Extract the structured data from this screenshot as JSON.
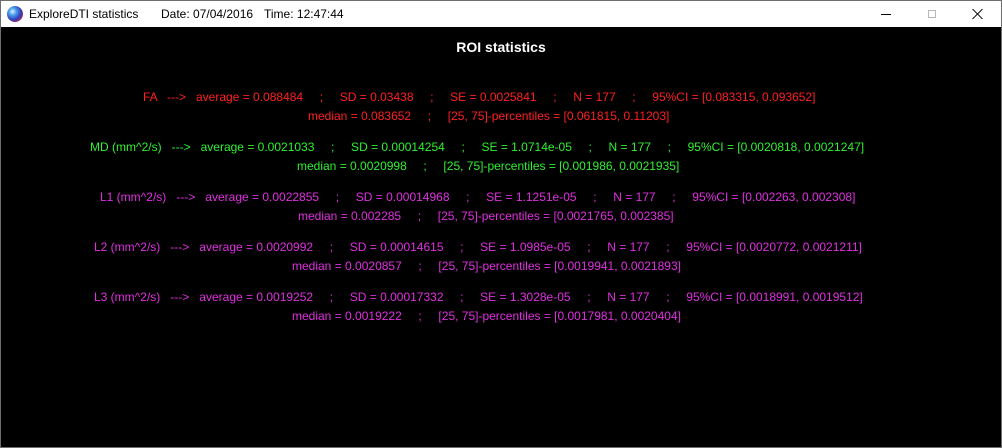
{
  "window": {
    "title": "ExploreDTI statistics",
    "date": "Date: 07/04/2016",
    "time": "Time: 12:47:44"
  },
  "content": {
    "heading": "ROI statistics",
    "rows": [
      {
        "color": "#ff2020",
        "line1": "FA   --->   average = 0.088484     ;     SD = 0.03438     ;     SE = 0.0025841     ;     N = 177     ;     95%CI = [0.083315, 0.093652]",
        "line2": "median = 0.083652     ;     [25, 75]-percentiles = [0.061815, 0.11203]"
      },
      {
        "color": "#30f030",
        "line1": "MD (mm^2/s)   --->   average = 0.0021033     ;     SD = 0.00014254     ;     SE = 1.0714e-05     ;     N = 177     ;     95%CI = [0.0020818, 0.0021247]",
        "line2": "median = 0.0020998     ;     [25, 75]-percentiles = [0.001986, 0.0021935]"
      },
      {
        "color": "#e030e0",
        "line1": "L1 (mm^2/s)   --->   average = 0.0022855     ;     SD = 0.00014968     ;     SE = 1.1251e-05     ;     N = 177     ;     95%CI = [0.002263, 0.002308]",
        "line2": "median = 0.002285     ;     [25, 75]-percentiles = [0.0021765, 0.002385]"
      },
      {
        "color": "#e030e0",
        "line1": "L2 (mm^2/s)   --->   average = 0.0020992     ;     SD = 0.00014615     ;     SE = 1.0985e-05     ;     N = 177     ;     95%CI = [0.0020772, 0.0021211]",
        "line2": "median = 0.0020857     ;     [25, 75]-percentiles = [0.0019941, 0.0021893]"
      },
      {
        "color": "#e030e0",
        "line1": "L3 (mm^2/s)   --->   average = 0.0019252     ;     SD = 0.00017332     ;     SE = 1.3028e-05     ;     N = 177     ;     95%CI = [0.0018991, 0.0019512]",
        "line2": "median = 0.0019222     ;     [25, 75]-percentiles = [0.0017981, 0.0020404]"
      }
    ]
  },
  "icons": {
    "app": "explore-dti-icon",
    "minimize": "minimize-icon",
    "maximize": "maximize-icon",
    "close": "close-icon"
  }
}
